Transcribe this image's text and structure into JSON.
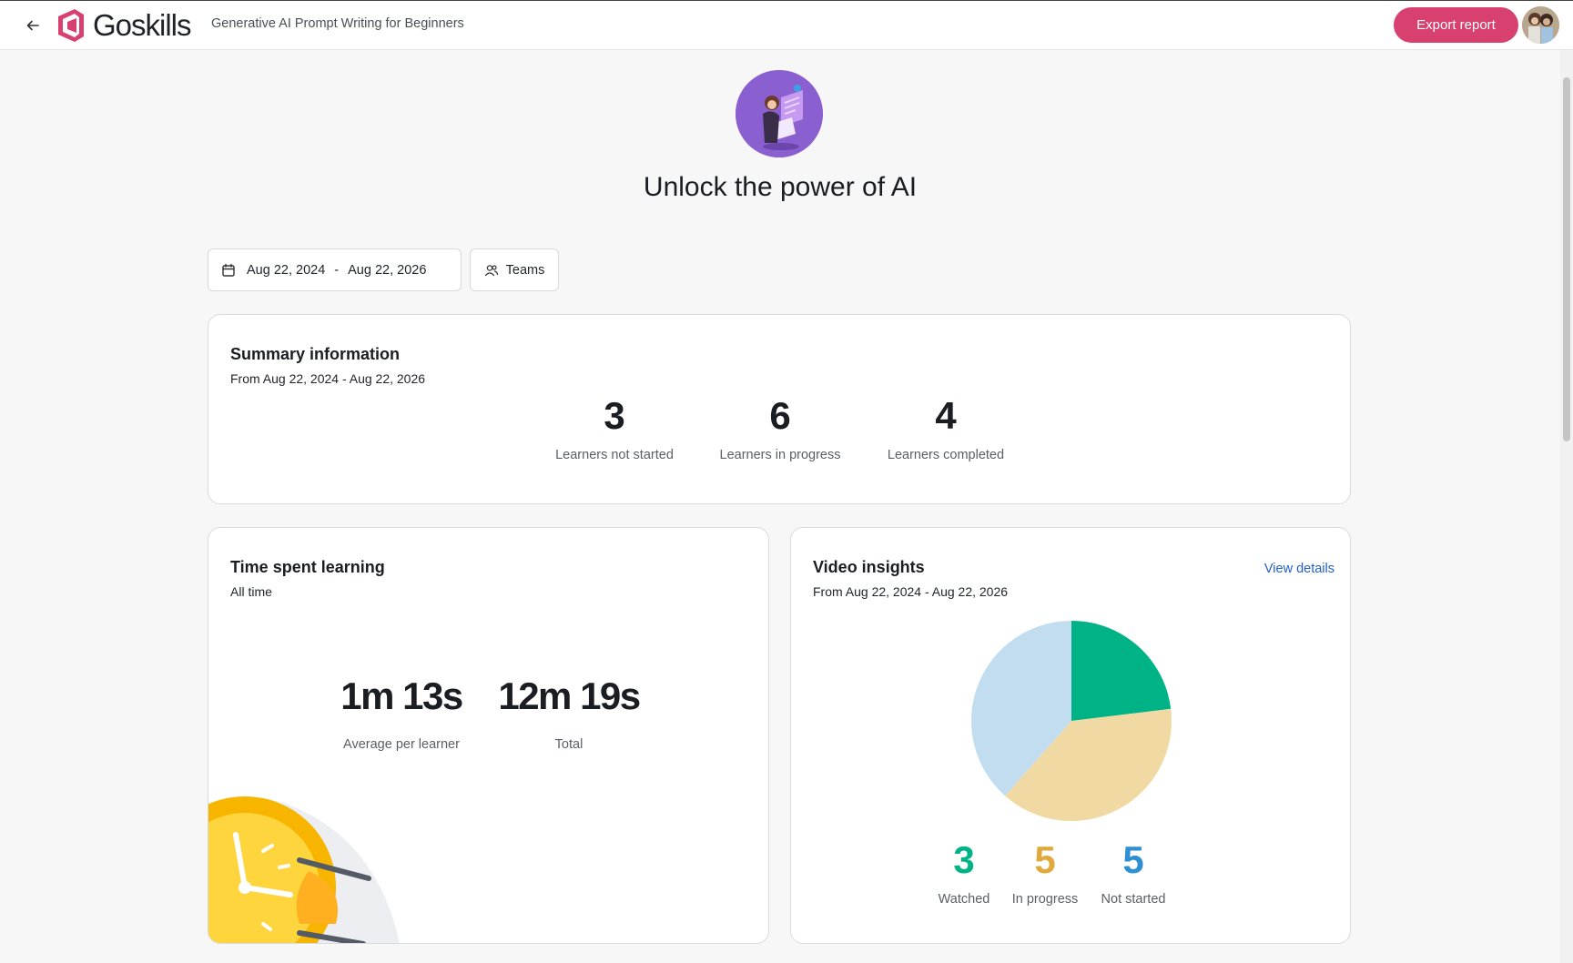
{
  "header": {
    "logo_text": "Goskills",
    "course_title": "Generative AI Prompt Writing for Beginners",
    "export_label": "Export report"
  },
  "hero": {
    "title": "Unlock the power of AI"
  },
  "filters": {
    "date_start": "Aug 22, 2024",
    "date_separator": "-",
    "date_end": "Aug 22, 2026",
    "teams_label": "Teams"
  },
  "summary": {
    "title": "Summary information",
    "subtitle": "From Aug 22, 2024 - Aug 22, 2026",
    "stats": [
      {
        "value": "3",
        "label": "Learners not started"
      },
      {
        "value": "6",
        "label": "Learners in progress"
      },
      {
        "value": "4",
        "label": "Learners completed"
      }
    ]
  },
  "time_spent": {
    "title": "Time spent learning",
    "subtitle": "All time",
    "average": {
      "value": "1m 13s",
      "label": "Average per learner"
    },
    "total": {
      "value": "12m 19s",
      "label": "Total"
    }
  },
  "video_insights": {
    "title": "Video insights",
    "subtitle": "From Aug 22, 2024 - Aug 22, 2026",
    "view_details_label": "View details",
    "legend": [
      {
        "value": "3",
        "label": "Watched",
        "color": "#00b386"
      },
      {
        "value": "5",
        "label": "In progress",
        "color": "#e0a93a"
      },
      {
        "value": "5",
        "label": "Not started",
        "color": "#2e8fd1"
      }
    ]
  },
  "chart_data": {
    "type": "pie",
    "categories": [
      "Watched",
      "In progress",
      "Not started"
    ],
    "values": [
      3,
      5,
      5
    ],
    "colors": [
      "#00b386",
      "#f0d9a3",
      "#c2ddf0"
    ],
    "start_angle_deg": 0
  },
  "colors": {
    "accent": "#d8406f",
    "link": "#1f5ecf"
  }
}
